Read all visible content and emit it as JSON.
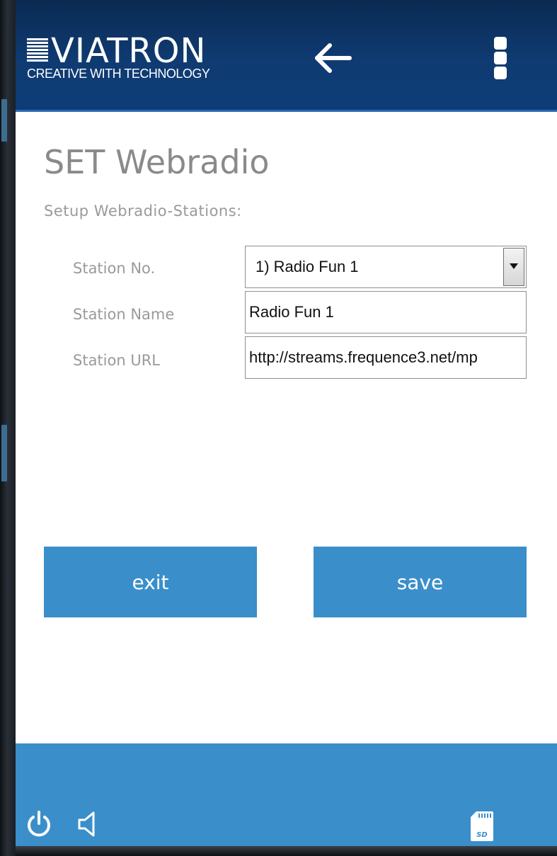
{
  "header": {
    "logo_name": "VIATRON",
    "logo_tagline": "CREATIVE WITH TECHNOLOGY",
    "back_icon": "arrow-left-icon",
    "menu_icon": "more-vertical-icon"
  },
  "page": {
    "title": "SET Webradio",
    "subtitle": "Setup Webradio-Stations:"
  },
  "form": {
    "station_no_label": "Station No.",
    "station_no_value": "1) Radio Fun 1",
    "station_name_label": "Station Name",
    "station_name_value": "Radio Fun 1",
    "station_url_label": "Station URL",
    "station_url_value": "http://streams.frequence3.net/mp"
  },
  "buttons": {
    "exit_label": "exit",
    "save_label": "save"
  },
  "footer": {
    "icons": [
      "power-icon",
      "speaker-icon",
      "sd-card-icon"
    ],
    "sd_label": "SD"
  },
  "colors": {
    "header_bg": "#0f3b72",
    "accent": "#3a8fca",
    "label_text": "#9a9a9a",
    "title_text": "#8a8a8a"
  }
}
